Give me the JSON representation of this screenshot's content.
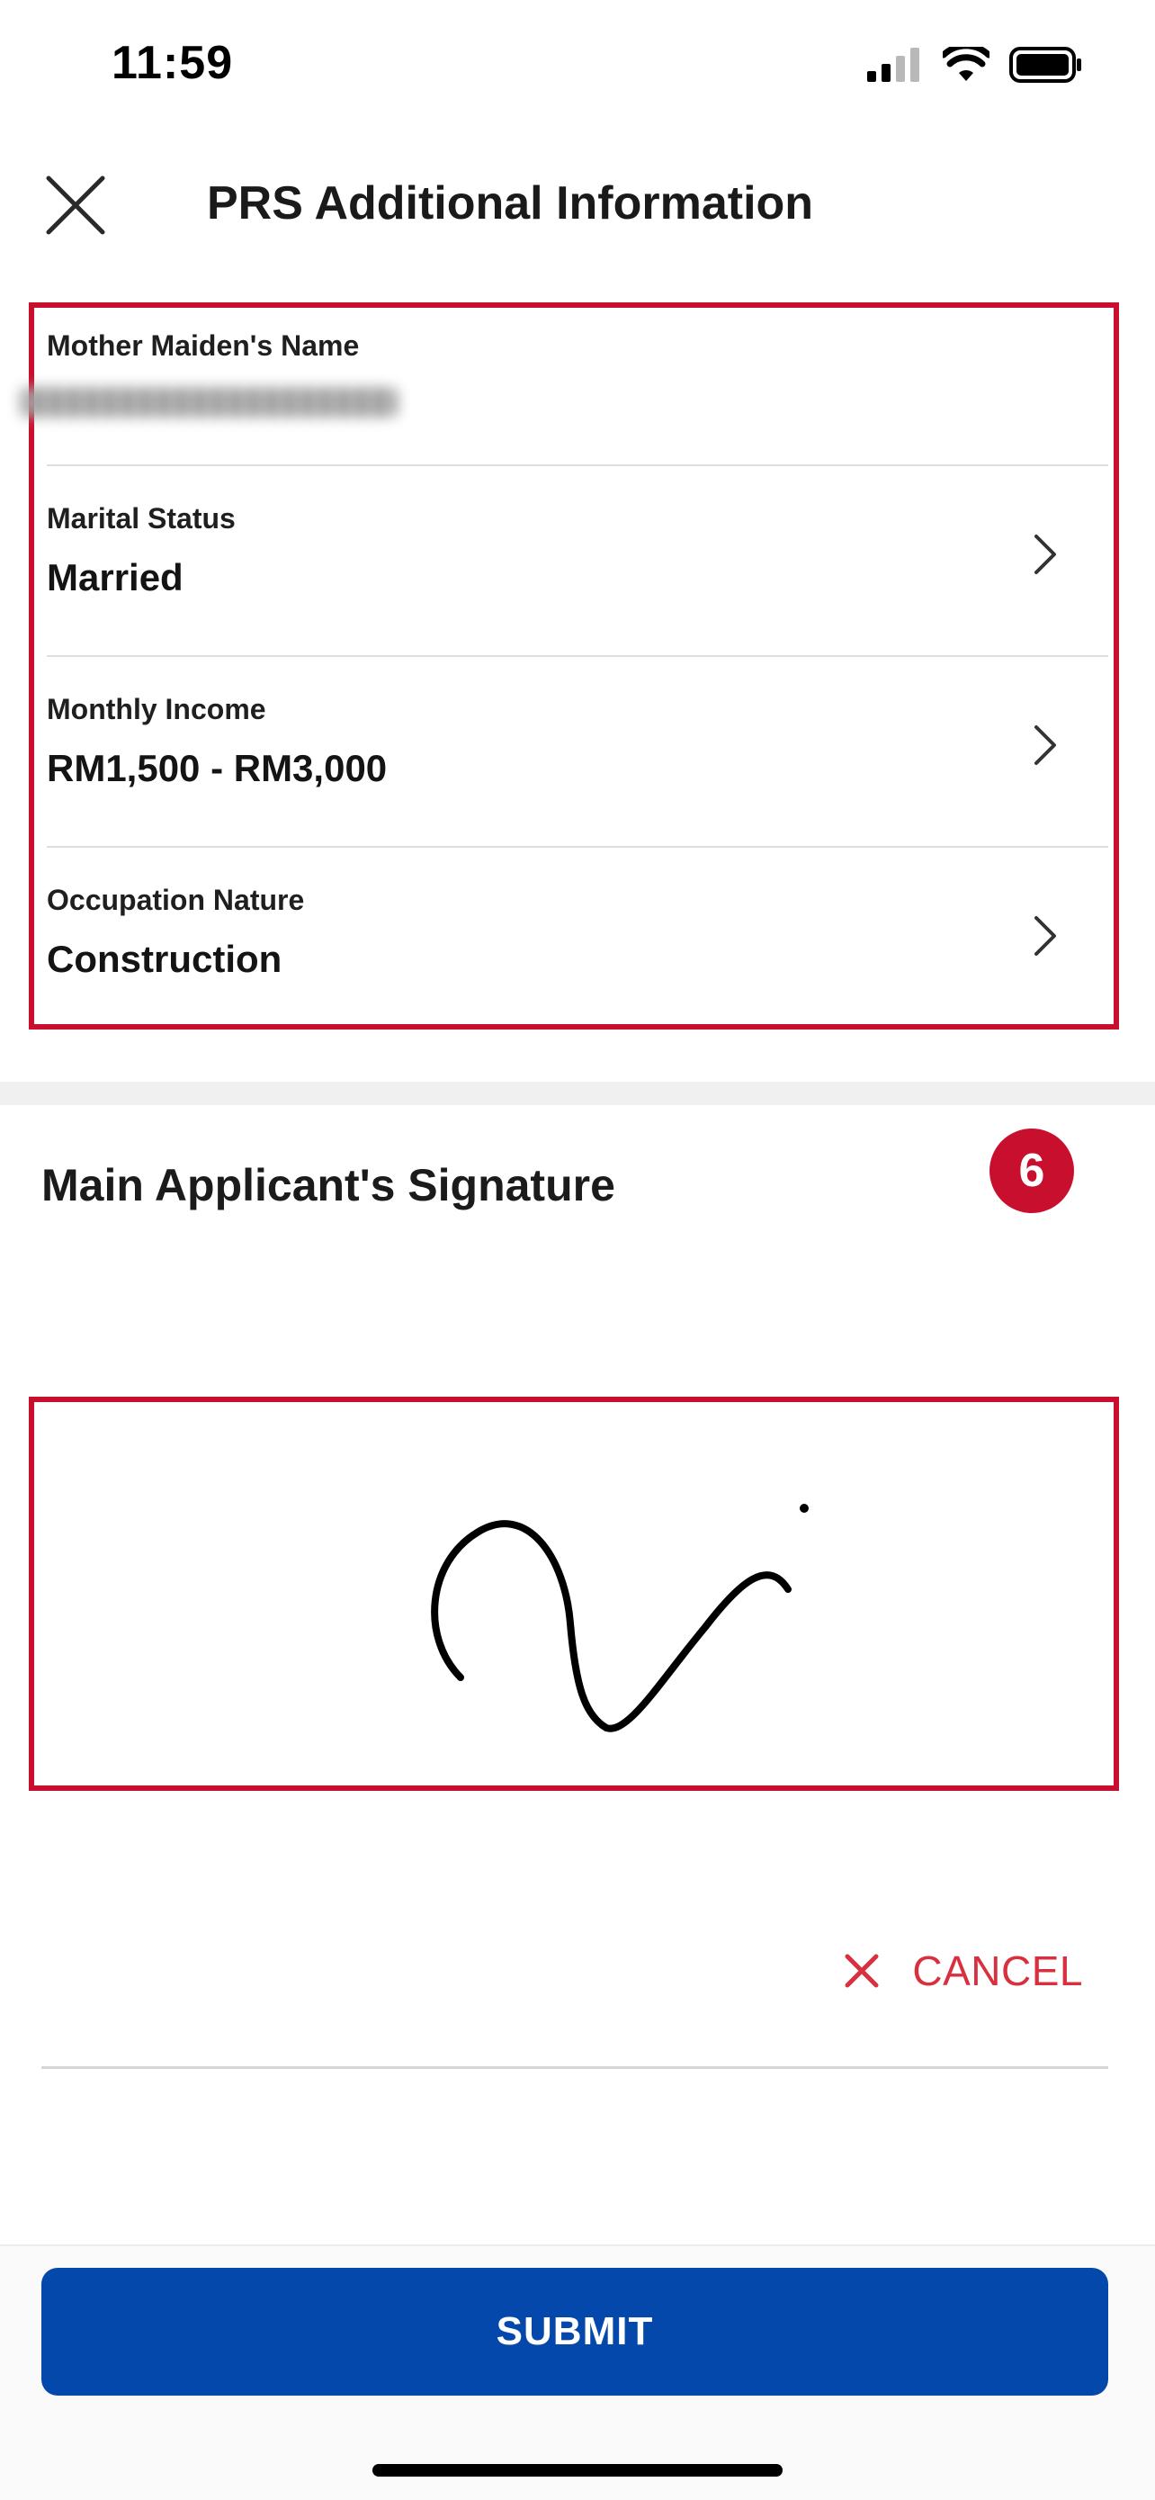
{
  "status_bar": {
    "time": "11:59",
    "icons": [
      "cellular-signal-icon",
      "wifi-icon",
      "battery-icon"
    ]
  },
  "header": {
    "title": "PRS Additional Information",
    "close_icon": "close-icon"
  },
  "form": {
    "fields": [
      {
        "label": "Mother Maiden's Name",
        "value": "",
        "masked": true
      },
      {
        "label": "Marital Status",
        "value": "Married"
      },
      {
        "label": "Monthly Income",
        "value": "RM1,500 - RM3,000"
      },
      {
        "label": "Occupation Nature",
        "value": "Construction"
      }
    ]
  },
  "signature": {
    "title": "Main Applicant's Signature",
    "step_badge": "6",
    "cancel_label": "CANCEL"
  },
  "footer": {
    "submit_label": "SUBMIT"
  },
  "colors": {
    "highlight_red": "#c8102e",
    "cancel_red": "#d9303f",
    "submit_blue": "#0448ab"
  }
}
